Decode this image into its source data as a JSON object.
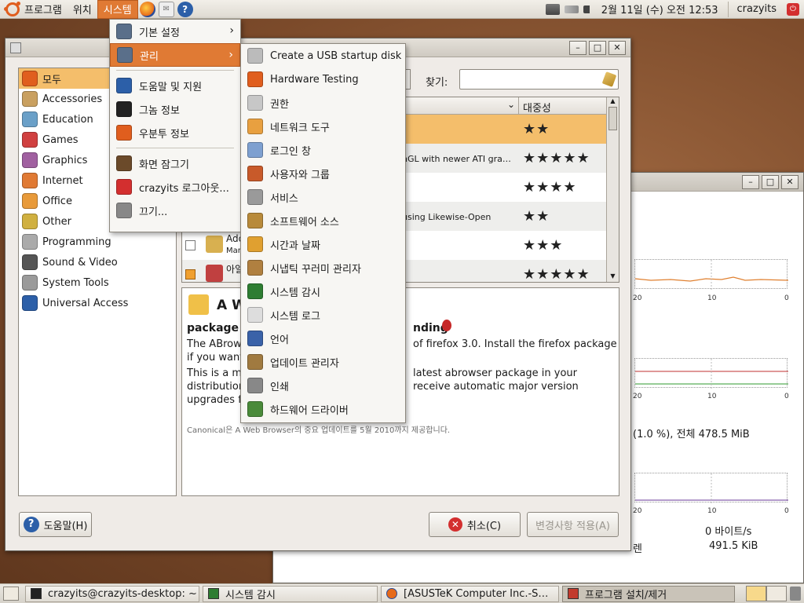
{
  "top_panel": {
    "menus": [
      "프로그램",
      "위치",
      "시스템"
    ],
    "clock": "2월 11일 (수) 오전 12:53",
    "user": "crazyits"
  },
  "system_menu": {
    "items": [
      {
        "label": "기본 설정",
        "icon": "preferences-icon",
        "submenu": true,
        "color": "#5a6f8a"
      },
      {
        "label": "관리",
        "icon": "administration-icon",
        "submenu": true,
        "color": "#5a6f8a"
      },
      {
        "label": "도움말 및 지원",
        "icon": "help-icon",
        "color": "#2c5fa8"
      },
      {
        "label": "그놈 정보",
        "icon": "gnome-foot-icon",
        "color": "#222222"
      },
      {
        "label": "우분투 정보",
        "icon": "ubuntu-icon",
        "color": "#e05e1e"
      },
      {
        "label": "화면 잠그기",
        "icon": "lock-screen-icon",
        "color": "#6b4a2a"
      },
      {
        "label": "crazyits 로그아웃...",
        "icon": "logout-icon",
        "color": "#d32f2f"
      },
      {
        "label": "끄기...",
        "icon": "shutdown-icon",
        "color": "#888888"
      }
    ]
  },
  "admin_menu": {
    "items": [
      {
        "label": "Create a USB startup disk",
        "icon": "usb-disk-icon",
        "color": "#bbbbbb"
      },
      {
        "label": "Hardware Testing",
        "icon": "ubuntu-icon",
        "color": "#e05e1e"
      },
      {
        "label": "권한",
        "icon": "keys-icon",
        "color": "#c7c7c7"
      },
      {
        "label": "네트워크 도구",
        "icon": "network-tools-icon",
        "color": "#e8a040"
      },
      {
        "label": "로그인 창",
        "icon": "login-window-icon",
        "color": "#7ea0d0"
      },
      {
        "label": "사용자와 그룹",
        "icon": "users-groups-icon",
        "color": "#c85a2a"
      },
      {
        "label": "서비스",
        "icon": "services-icon",
        "color": "#9a9a9a"
      },
      {
        "label": "소프트웨어 소스",
        "icon": "software-sources-icon",
        "color": "#b88a3a"
      },
      {
        "label": "시간과 날짜",
        "icon": "time-date-icon",
        "color": "#e0a030"
      },
      {
        "label": "시냅틱 꾸러미 관리자",
        "icon": "synaptic-icon",
        "color": "#b08040"
      },
      {
        "label": "시스템 감시",
        "icon": "system-monitor-icon",
        "color": "#2e7d32"
      },
      {
        "label": "시스템 로그",
        "icon": "system-log-icon",
        "color": "#dddddd"
      },
      {
        "label": "언어",
        "icon": "language-flag-icon",
        "color": "#3a62a8"
      },
      {
        "label": "업데이트 관리자",
        "icon": "update-manager-icon",
        "color": "#a07a40"
      },
      {
        "label": "인쇄",
        "icon": "printer-icon",
        "color": "#888888"
      },
      {
        "label": "하드웨어 드라이버",
        "icon": "hardware-drivers-icon",
        "color": "#4a8a3a"
      }
    ]
  },
  "addremove": {
    "categories": [
      {
        "label": "모두",
        "icon": "ubuntu-icon",
        "color": "#e05e1e"
      },
      {
        "label": "Accessories",
        "icon": "accessories-icon",
        "color": "#c9a060"
      },
      {
        "label": "Education",
        "icon": "education-icon",
        "color": "#6aa0c8"
      },
      {
        "label": "Games",
        "icon": "games-icon",
        "color": "#d04040"
      },
      {
        "label": "Graphics",
        "icon": "graphics-icon",
        "color": "#a060a0"
      },
      {
        "label": "Internet",
        "icon": "internet-icon",
        "color": "#e07a34"
      },
      {
        "label": "Office",
        "icon": "office-icon",
        "color": "#e89a3a"
      },
      {
        "label": "Other",
        "icon": "other-icon",
        "color": "#d0b040"
      },
      {
        "label": "Programming",
        "icon": "programming-icon",
        "color": "#aaaaaa"
      },
      {
        "label": "Sound & Video",
        "icon": "sound-video-icon",
        "color": "#555555"
      },
      {
        "label": "System Tools",
        "icon": "system-tools-icon",
        "color": "#9a9a9a"
      },
      {
        "label": "Universal Access",
        "icon": "universal-access-icon",
        "color": "#2c5fa8"
      }
    ],
    "search_label": "찾기:",
    "search_value": "",
    "popularity_header": "대중성",
    "rows": [
      {
        "desc": "",
        "stars": "★★",
        "style": "sel",
        "name": "",
        "sub": ""
      },
      {
        "desc": "nGL with newer ATI gra…",
        "stars": "★★★★★",
        "style": "alt",
        "name": "",
        "sub": ""
      },
      {
        "desc": "",
        "stars": "★★★★",
        "style": "",
        "name": "",
        "sub": ""
      },
      {
        "desc": "using Likewise-Open",
        "stars": "★★",
        "style": "alt",
        "name": "",
        "sub": ""
      },
      {
        "desc": "",
        "stars": "★★★",
        "style": "",
        "name": "Ado",
        "sub": "Mar"
      },
      {
        "desc": "",
        "stars": "★★★★★",
        "style": "alt",
        "name": "아일",
        "sub": ""
      }
    ],
    "detail": {
      "title": "A W",
      "subhead_left": "package",
      "subhead_right": "nding",
      "p1a": "The ABrow",
      "p1b": "of firefox 3.0. Install the firefox package",
      "p2": "if you want",
      "p3a": "This is a m",
      "p3b": "latest abrowser package in your",
      "p4a": "distribution",
      "p4b": "receive automatic major version",
      "p5": "upgrades f",
      "footer": "Canonical은 A Web Browser의 중요 업데이트를 5월 2010까지 제공합니다."
    },
    "help_button": "도움말(H)",
    "cancel_button": "취소(C)",
    "apply_button": "변경사항 적용(A)"
  },
  "sysmon": {
    "axis_a": [
      "20",
      "10",
      "0"
    ],
    "axis_b": [
      "20",
      "10",
      "0"
    ],
    "axis_c": [
      "20",
      "10",
      "0"
    ],
    "memory_text": "(1.0 %), 전체 478.5 MiB",
    "net_rate": "0 바이트/s",
    "net_total": "491.5 KiB",
    "net_total_prefix": "렌"
  },
  "taskbar": {
    "tasks": [
      {
        "label": "crazyits@crazyits-desktop: ~",
        "icon": "terminal-icon"
      },
      {
        "label": "시스템 감시",
        "icon": "system-monitor-icon"
      },
      {
        "label": "[ASUSTeK Computer Inc.-S…",
        "icon": "firefox-icon"
      },
      {
        "label": "프로그램 설치/제거",
        "icon": "add-remove-icon"
      }
    ]
  }
}
